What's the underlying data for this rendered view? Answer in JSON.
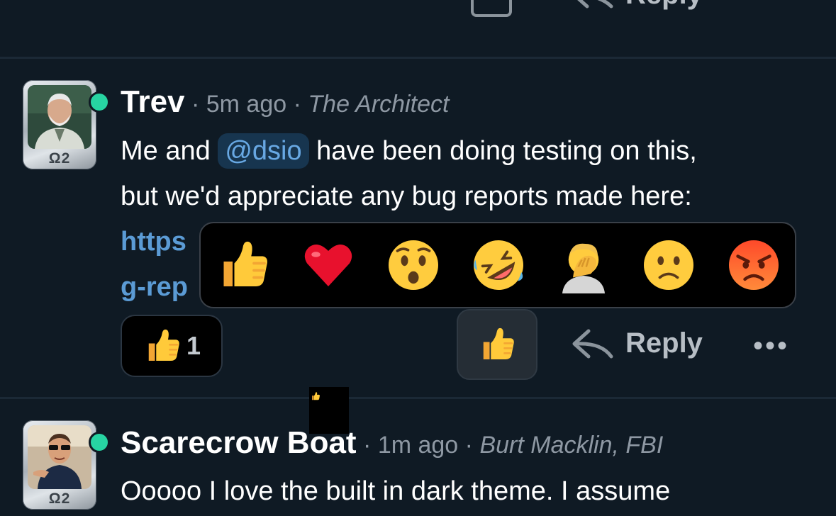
{
  "top_actions": {
    "reply_label": "Reply",
    "more_label": "•••"
  },
  "posts": [
    {
      "avatar_label": "Ω2",
      "username": "Trev",
      "separator": "·",
      "time": "5m ago",
      "title": "The Architect",
      "body_prefix": "Me and",
      "mention": "@dsio",
      "body_line1_rest": "have been doing testing on this,",
      "body_line2": "but we'd appreciate any bug reports made here:",
      "link_line1": "https",
      "link_line2": "g-rep",
      "reaction_count": "1",
      "reply_label": "Reply",
      "more_label": "•••"
    },
    {
      "avatar_label": "Ω2",
      "username": "Scarecrow Boat",
      "separator": "·",
      "time": "1m ago",
      "title": "Burt Macklin, FBI",
      "body_line1": "Ooooo I love the built in dark theme. I assume"
    }
  ],
  "emoji_picker": {
    "options": [
      "thumbs-up",
      "red-heart",
      "hushed-face",
      "rolling-on-floor-laughing",
      "face-palm",
      "slightly-frowning-face",
      "angry-face"
    ]
  },
  "colors": {
    "background": "#0f1a24",
    "online": "#27d4a2",
    "link": "#5b9bd5",
    "mention_bg": "#17354f"
  }
}
